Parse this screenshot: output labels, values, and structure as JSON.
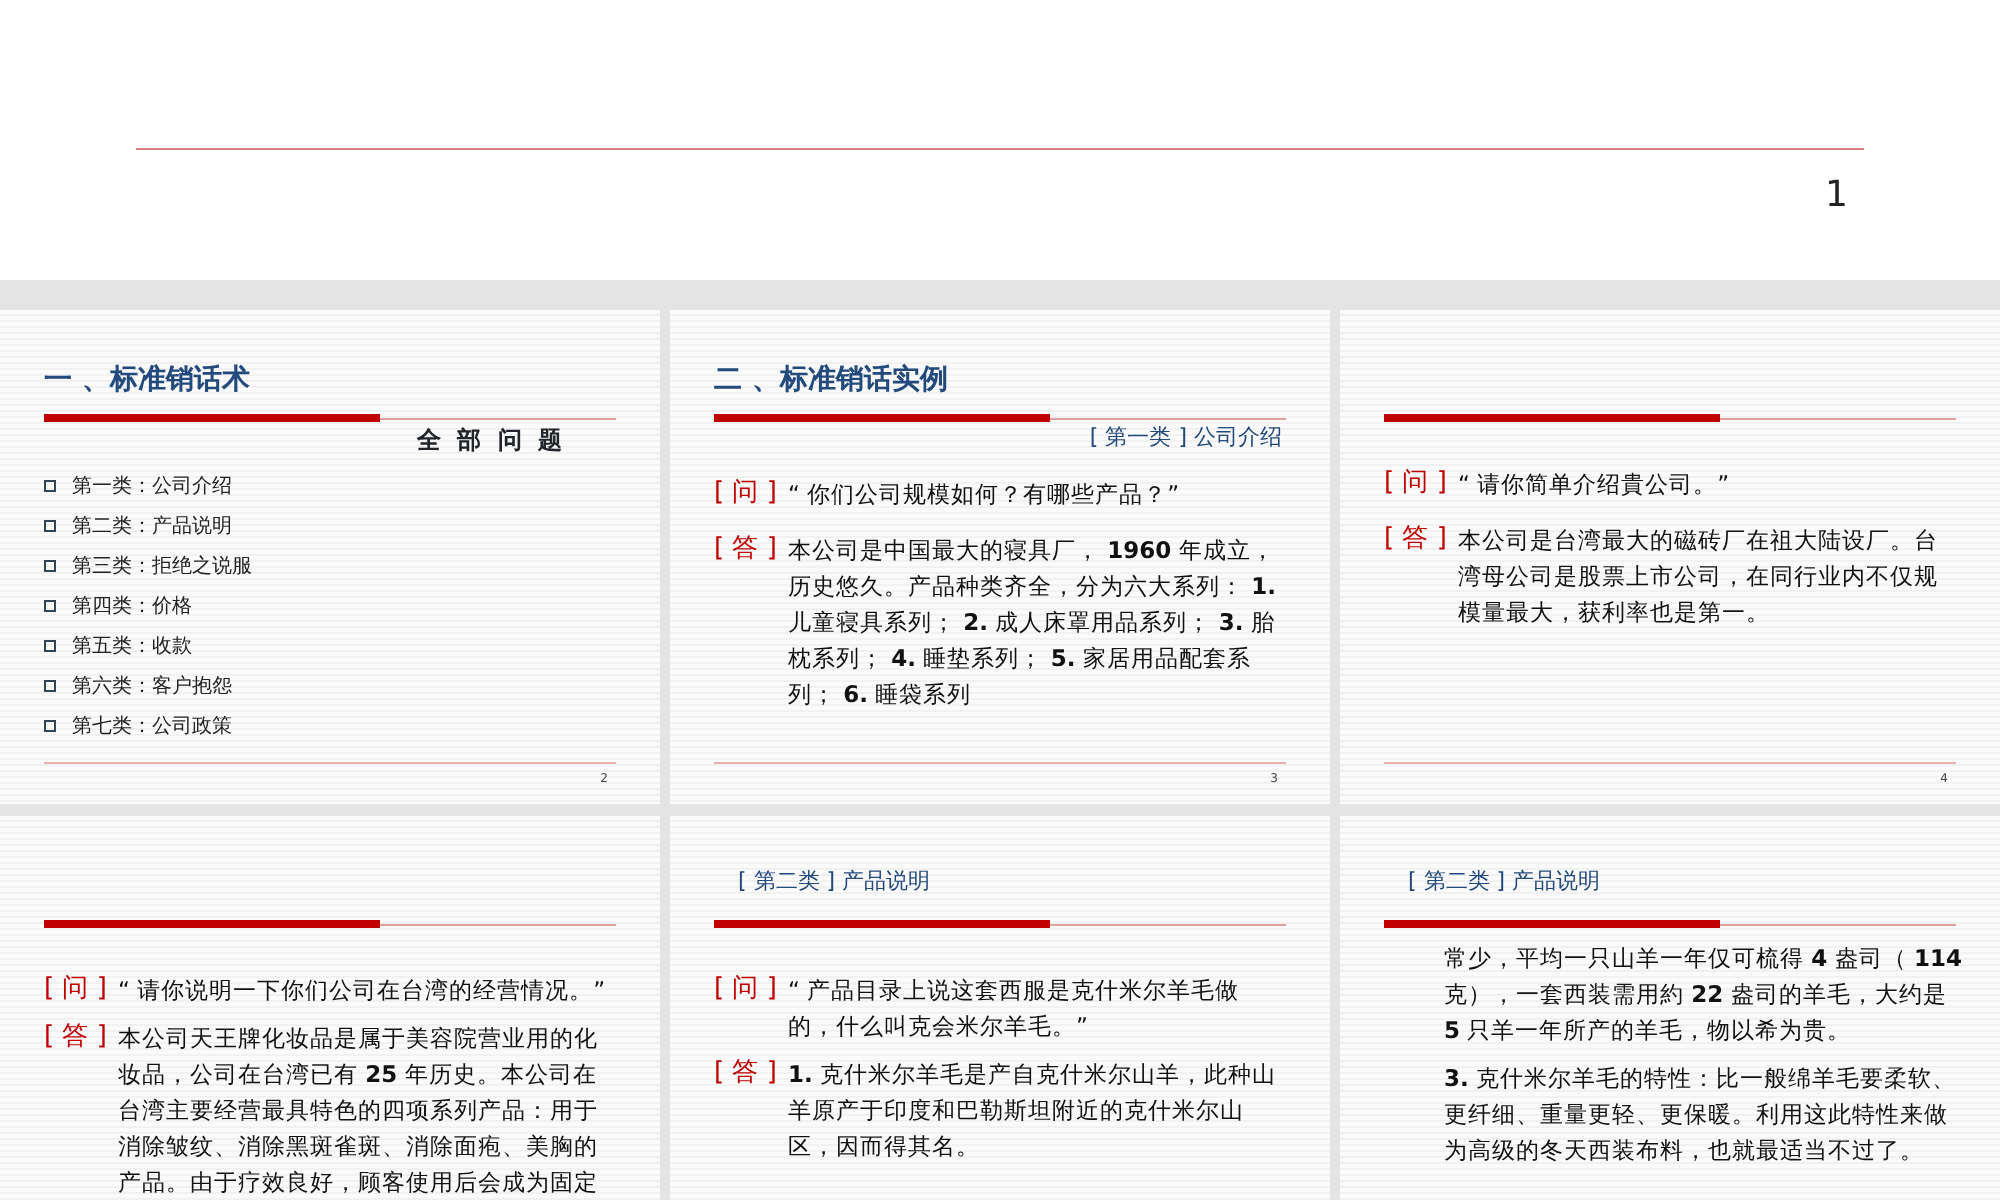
{
  "top_slide": {
    "page_number": "1"
  },
  "slides": [
    {
      "title": "一 、标准销话术",
      "subheading": {
        "kind": "heading",
        "text": "全 部 问 题"
      },
      "blocks": [
        {
          "kind": "bullet",
          "text": "第一类：公司介绍"
        },
        {
          "kind": "bullet",
          "text": "第二类：产品说明"
        },
        {
          "kind": "bullet",
          "text": "第三类：拒绝之说服"
        },
        {
          "kind": "bullet",
          "text": "第四类：价格"
        },
        {
          "kind": "bullet",
          "text": "第五类：收款"
        },
        {
          "kind": "bullet",
          "text": "第六类：客户抱怨"
        },
        {
          "kind": "bullet",
          "text": "第七类：公司政策"
        }
      ],
      "page_number": "2"
    },
    {
      "title": "二 、标准销话实例",
      "subheading": {
        "kind": "category",
        "tag": "[ 第一类 ]",
        "text": "公司介绍"
      },
      "blocks": [
        {
          "kind": "qa",
          "label": "[ 问 ]",
          "text": "“ 你们公司规模如何？有哪些产品？”"
        },
        {
          "kind": "qa",
          "label": "[ 答 ]",
          "text": "本公司是中国最大的寝具厂， **1960** 年成立，历史悠久。产品种类齐全，分为六大系列： **1.** 儿童寝具系列； **2.** 成人床罩用品系列； **3.** 胎枕系列； **4.** 睡垫系列； **5.** 家居用品配套系列； **6.** 睡袋系列"
        }
      ],
      "page_number": "3"
    },
    {
      "blocks": [
        {
          "kind": "qa",
          "label": "[ 问 ]",
          "text": "“ 请你简单介绍貴公司。”"
        },
        {
          "kind": "qa",
          "label": "[ 答 ]",
          "text": "本公司是台湾最大的磁砖厂在祖大陆设厂。台湾母公司是股票上市公司，在同行业内不仅规模量最大，获利率也是第一。"
        }
      ],
      "page_number": "4"
    },
    {
      "blocks": [
        {
          "kind": "qa",
          "label": "[ 问 ]",
          "text": "“ 请你说明一下你们公司在台湾的经营情况。”"
        },
        {
          "kind": "qa",
          "label": "[ 答 ]",
          "text": "本公司天王牌化妆品是属于美容院营业用的化妆品，公司在台湾已有 **25** 年历史。本公司在台湾主要经营最具特色的四项系列产品：用于消除皱纹、消除黑斑雀斑、消除面疱、美胸的产品。由于疗效良好，顾客使用后会成为固定"
        }
      ]
    },
    {
      "header_tag": {
        "tag": "[ 第二类 ]",
        "text": "产品说明"
      },
      "blocks": [
        {
          "kind": "qa",
          "label": "[ 问 ]",
          "text": "“ 产品目录上说这套西服是克什米尔羊毛做的，什么叫克会米尔羊毛。”"
        },
        {
          "kind": "qa",
          "label": "[ 答 ]",
          "text": "**1.** 克什米尔羊毛是产自克什米尔山羊，此种山羊原产于印度和巴勒斯坦附近的克什米尔山区，因而得其名。"
        }
      ]
    },
    {
      "header_tag": {
        "tag": "[ 第二类 ]",
        "text": "产品说明"
      },
      "blocks": [
        {
          "kind": "para",
          "text": "常少，平均一只山羊一年仅可梳得 **4** 盎司（ **114** 克），一套西装需用約 **22** 盎司的羊毛，大约是 **5** 只羊一年所产的羊毛，物以希为贵。"
        },
        {
          "kind": "para",
          "text": "**3.** 克什米尔羊毛的特性：比一般绵羊毛要柔软、更纤细、重量更轻、更保暖。利用这此特性来做为高级的冬天西装布料，也就最适当不过了。"
        }
      ]
    }
  ]
}
